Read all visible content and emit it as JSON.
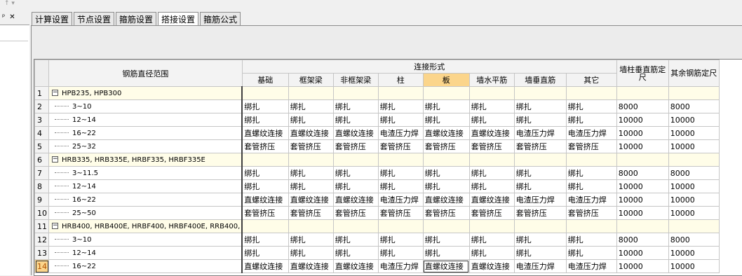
{
  "left_panel": {
    "dropdown_label": "↑ ▾",
    "pin_icon": "ᵖ",
    "close_icon": "✕"
  },
  "tabs": [
    {
      "label": "计算设置",
      "active": false
    },
    {
      "label": "节点设置",
      "active": false
    },
    {
      "label": "箍筋设置",
      "active": false
    },
    {
      "label": "搭接设置",
      "active": true
    },
    {
      "label": "箍筋公式",
      "active": false
    }
  ],
  "grid": {
    "header": {
      "range": "钢筋直径范围",
      "group": "连接形式",
      "connection_cols": [
        "基础",
        "框架梁",
        "非框架梁",
        "柱",
        "板",
        "墙水平筋",
        "墙垂直筋",
        "其它"
      ],
      "length_cols": [
        "墙柱垂直筋定尺",
        "其余钢筋定尺"
      ]
    },
    "rows": [
      {
        "num": "1",
        "group": true,
        "label": "HPB235, HPB300",
        "cells": [
          "",
          "",
          "",
          "",
          "",
          "",
          "",
          "",
          "",
          ""
        ]
      },
      {
        "num": "2",
        "group": false,
        "label": "3~10",
        "cells": [
          "绑扎",
          "绑扎",
          "绑扎",
          "绑扎",
          "绑扎",
          "绑扎",
          "绑扎",
          "绑扎",
          "8000",
          "8000"
        ]
      },
      {
        "num": "3",
        "group": false,
        "label": "12~14",
        "cells": [
          "绑扎",
          "绑扎",
          "绑扎",
          "绑扎",
          "绑扎",
          "绑扎",
          "绑扎",
          "绑扎",
          "10000",
          "10000"
        ]
      },
      {
        "num": "4",
        "group": false,
        "label": "16~22",
        "cells": [
          "直螺纹连接",
          "直螺纹连接",
          "直螺纹连接",
          "电渣压力焊",
          "直螺纹连接",
          "直螺纹连接",
          "电渣压力焊",
          "电渣压力焊",
          "10000",
          "10000"
        ]
      },
      {
        "num": "5",
        "group": false,
        "label": "25~32",
        "cells": [
          "套管挤压",
          "套管挤压",
          "套管挤压",
          "套管挤压",
          "套管挤压",
          "套管挤压",
          "套管挤压",
          "套管挤压",
          "10000",
          "10000"
        ]
      },
      {
        "num": "6",
        "group": true,
        "label": "HRB335, HRB335E, HRBF335, HRBF335E",
        "cells": [
          "",
          "",
          "",
          "",
          "",
          "",
          "",
          "",
          "",
          ""
        ]
      },
      {
        "num": "7",
        "group": false,
        "label": "3~11.5",
        "cells": [
          "绑扎",
          "绑扎",
          "绑扎",
          "绑扎",
          "绑扎",
          "绑扎",
          "绑扎",
          "绑扎",
          "8000",
          "8000"
        ]
      },
      {
        "num": "8",
        "group": false,
        "label": "12~14",
        "cells": [
          "绑扎",
          "绑扎",
          "绑扎",
          "绑扎",
          "绑扎",
          "绑扎",
          "绑扎",
          "绑扎",
          "10000",
          "10000"
        ]
      },
      {
        "num": "9",
        "group": false,
        "label": "16~22",
        "cells": [
          "直螺纹连接",
          "直螺纹连接",
          "直螺纹连接",
          "电渣压力焊",
          "直螺纹连接",
          "直螺纹连接",
          "电渣压力焊",
          "电渣压力焊",
          "10000",
          "10000"
        ]
      },
      {
        "num": "10",
        "group": false,
        "label": "25~50",
        "cells": [
          "套管挤压",
          "套管挤压",
          "套管挤压",
          "套管挤压",
          "套管挤压",
          "套管挤压",
          "套管挤压",
          "套管挤压",
          "10000",
          "10000"
        ]
      },
      {
        "num": "11",
        "group": true,
        "label": "HRB400, HRB400E, HRBF400, HRBF400E, RRB400,",
        "cells": [
          "",
          "",
          "",
          "",
          "",
          "",
          "",
          "",
          "",
          ""
        ]
      },
      {
        "num": "12",
        "group": false,
        "label": "3~10",
        "cells": [
          "绑扎",
          "绑扎",
          "绑扎",
          "绑扎",
          "绑扎",
          "绑扎",
          "绑扎",
          "绑扎",
          "8000",
          "8000"
        ]
      },
      {
        "num": "13",
        "group": false,
        "label": "12~14",
        "cells": [
          "绑扎",
          "绑扎",
          "绑扎",
          "绑扎",
          "绑扎",
          "绑扎",
          "绑扎",
          "绑扎",
          "10000",
          "10000"
        ]
      },
      {
        "num": "14",
        "group": false,
        "label": "16~22",
        "cells": [
          "直螺纹连接",
          "直螺纹连接",
          "直螺纹连接",
          "电渣压力焊",
          "直螺纹连接",
          "直螺纹连接",
          "电渣压力焊",
          "电渣压力焊",
          "10000",
          "10000"
        ]
      }
    ],
    "selected": {
      "row": 13,
      "col": 4
    }
  }
}
